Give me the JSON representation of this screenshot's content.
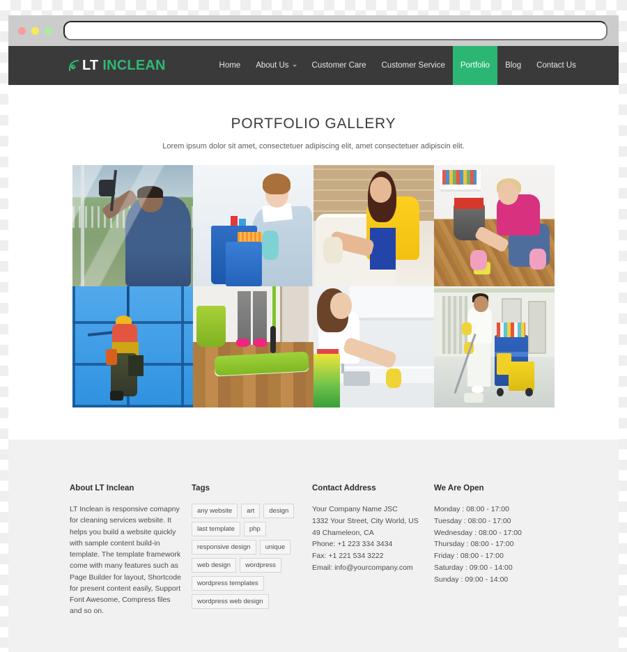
{
  "browser": {
    "traffic_lights": [
      "close",
      "minimize",
      "maximize"
    ],
    "address_value": "",
    "address_placeholder": ""
  },
  "header": {
    "logo": {
      "icon": "vacuum-swoosh-icon",
      "text_primary": "LT",
      "text_secondary": "INCLEAN"
    },
    "nav": [
      {
        "label": "Home",
        "active": false,
        "has_dropdown": false
      },
      {
        "label": "About Us",
        "active": false,
        "has_dropdown": true
      },
      {
        "label": "Customer Care",
        "active": false,
        "has_dropdown": false
      },
      {
        "label": "Customer Service",
        "active": false,
        "has_dropdown": false
      },
      {
        "label": "Portfolio",
        "active": true,
        "has_dropdown": false
      },
      {
        "label": "Blog",
        "active": false,
        "has_dropdown": false
      },
      {
        "label": "Contact Us",
        "active": false,
        "has_dropdown": false
      }
    ]
  },
  "main": {
    "title": "PORTFOLIO GALLERY",
    "subtitle": "Lorem ipsum dolor sit amet, consectetuer adipiscing elit, amet consectetuer adipiscin elit.",
    "gallery": [
      {
        "alt": "Man cleaning a window with a squeegee outdoors"
      },
      {
        "alt": "Smiling woman in uniform holding a blue cleaning bucket with orange cloth"
      },
      {
        "alt": "Woman in yellow shirt scrubbing a bathtub"
      },
      {
        "alt": "Blonde woman in pink top scrubbing a wooden floor beside a bucket"
      },
      {
        "alt": "Rope access worker cleaning a blue glass building facade"
      },
      {
        "alt": "Green flat mop on a wooden floor with pink slippers"
      },
      {
        "alt": "Woman in apron cleaning a kitchen counter and sink"
      },
      {
        "alt": "Janitor mopping a hallway next to a cleaning cart"
      }
    ]
  },
  "footer": {
    "about": {
      "heading": "About LT Inclean",
      "body": "LT Inclean is responsive comapny for cleaning services website. It helps you build a website quickly with sample content build-in template. The template framework come with many features such as Page Builder for layout, Shortcode for present content easily, Support Font Awesome, Compress files and so on."
    },
    "tags": {
      "heading": "Tags",
      "items": [
        "any website",
        "art",
        "design",
        "last template",
        "php",
        "responsive design",
        "unique",
        "web design",
        "wordpress",
        "wordpress templates",
        "wordpress web design"
      ]
    },
    "contact": {
      "heading": "Contact Address",
      "lines": [
        "Your Company Name JSC",
        "1332 Your Street, City World, US",
        "49 Chameleon, CA",
        "Phone: +1 223 334 3434",
        "Fax: +1 221 534 3222",
        "Email: info@yourcompany.com"
      ]
    },
    "hours": {
      "heading": "We Are Open",
      "lines": [
        "Monday : 08:00 - 17:00",
        "Tuesday : 08:00 - 17:00",
        "Wednesday : 08:00 - 17:00",
        "Thursday : 08:00 - 17:00",
        "Friday : 08:00 - 17:00",
        "Saturday : 09:00 - 14:00",
        "Sunday : 09:00 - 14:00"
      ]
    }
  },
  "colors": {
    "accent_green": "#2bb673",
    "header_dark": "#3a3a3a",
    "chrome_gray": "#cccccc",
    "footer_bg": "#f1f1f1",
    "dot_close": "#fb9a9a",
    "dot_min": "#f6ec5a",
    "dot_max": "#a8ee9e"
  }
}
